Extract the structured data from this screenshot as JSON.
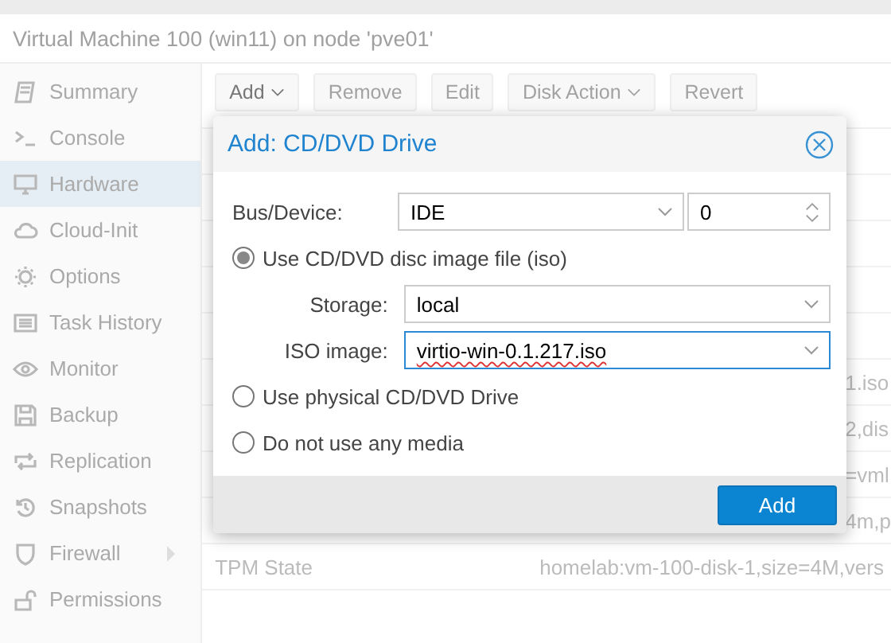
{
  "header": {
    "title": "Virtual Machine 100 (win11) on node 'pve01'"
  },
  "sidebar": {
    "items": [
      {
        "label": "Summary",
        "selected": false,
        "submenu": false
      },
      {
        "label": "Console",
        "selected": false,
        "submenu": false
      },
      {
        "label": "Hardware",
        "selected": true,
        "submenu": false
      },
      {
        "label": "Cloud-Init",
        "selected": false,
        "submenu": false
      },
      {
        "label": "Options",
        "selected": false,
        "submenu": false
      },
      {
        "label": "Task History",
        "selected": false,
        "submenu": false
      },
      {
        "label": "Monitor",
        "selected": false,
        "submenu": false
      },
      {
        "label": "Backup",
        "selected": false,
        "submenu": false
      },
      {
        "label": "Replication",
        "selected": false,
        "submenu": false
      },
      {
        "label": "Snapshots",
        "selected": false,
        "submenu": false
      },
      {
        "label": "Firewall",
        "selected": false,
        "submenu": true
      },
      {
        "label": "Permissions",
        "selected": false,
        "submenu": false
      }
    ]
  },
  "toolbar": [
    {
      "label": "Add",
      "menu": true,
      "disabled": false
    },
    {
      "label": "Remove",
      "menu": false,
      "disabled": true
    },
    {
      "label": "Edit",
      "menu": false,
      "disabled": true
    },
    {
      "label": "Disk Action",
      "menu": true,
      "disabled": true
    },
    {
      "label": "Revert",
      "menu": false,
      "disabled": true
    }
  ],
  "table": {
    "rows": [
      {
        "column_1": "",
        "column_2": ""
      },
      {
        "column_1": "",
        "column_2": ""
      },
      {
        "column_1": "",
        "column_2": ""
      },
      {
        "column_1": "",
        "column_2": ""
      },
      {
        "column_1": "",
        "column_2": ""
      },
      {
        "column_1": "",
        "column_2": "1.iso"
      },
      {
        "column_1": "",
        "column_2": "2,dis"
      },
      {
        "column_1": "",
        "column_2": "=vml"
      },
      {
        "column_1": "",
        "column_2": "4m,p"
      },
      {
        "column_1": "TPM State",
        "column_2": "homelab:vm-100-disk-1,size=4M,vers"
      }
    ]
  },
  "dialog": {
    "title": "Add: CD/DVD Drive",
    "bus_device": {
      "label": "Bus/Device:",
      "bus": "IDE",
      "device": "0"
    },
    "options": [
      {
        "label": "Use CD/DVD disc image file (iso)",
        "selected": true
      },
      {
        "label": "Use physical CD/DVD Drive",
        "selected": false
      },
      {
        "label": "Do not use any media",
        "selected": false
      }
    ],
    "storage": {
      "label": "Storage:",
      "value": "local"
    },
    "iso_image": {
      "label": "ISO image:",
      "value": "virtio-win-0.1.217.iso",
      "focused": true
    },
    "add_button": "Add"
  }
}
